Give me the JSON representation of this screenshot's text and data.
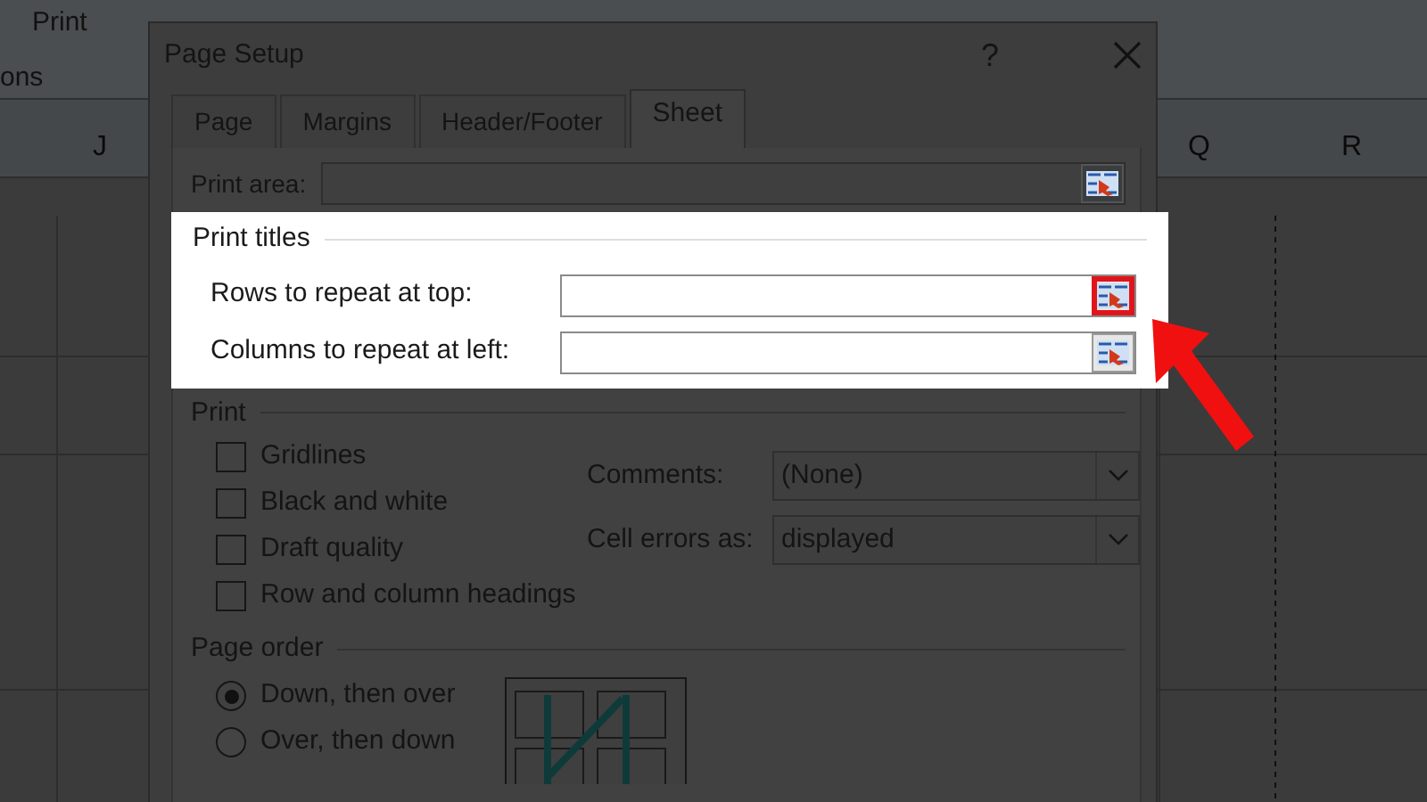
{
  "ribbon": {
    "items": [
      {
        "label": "Print"
      },
      {
        "label": "ons"
      }
    ]
  },
  "sheet": {
    "column_headers": [
      "J",
      "Q",
      "R"
    ]
  },
  "dialog": {
    "title": "Page Setup",
    "help": "?",
    "tabs": [
      {
        "label": "Page",
        "selected": false
      },
      {
        "label": "Margins",
        "selected": false
      },
      {
        "label": "Header/Footer",
        "selected": false
      },
      {
        "label": "Sheet",
        "selected": true
      }
    ],
    "print_area": {
      "label": "Print area:"
    },
    "print_titles": {
      "title": "Print titles",
      "fields": [
        {
          "label": "Rows to repeat at top:",
          "highlighted": true
        },
        {
          "label": "Columns to repeat at left:",
          "highlighted": false
        }
      ]
    },
    "print": {
      "title": "Print",
      "checkboxes": [
        {
          "label": "Gridlines",
          "checked": false
        },
        {
          "label": "Black and white",
          "checked": false
        },
        {
          "label": "Draft quality",
          "checked": false
        },
        {
          "label": "Row and column headings",
          "checked": false
        }
      ],
      "selects": [
        {
          "label": "Comments:",
          "value": "(None)"
        },
        {
          "label": "Cell errors as:",
          "value": "displayed"
        }
      ]
    },
    "page_order": {
      "title": "Page order",
      "options": [
        {
          "label": "Down, then over",
          "selected": true
        },
        {
          "label": "Over, then down",
          "selected": false
        }
      ]
    }
  }
}
